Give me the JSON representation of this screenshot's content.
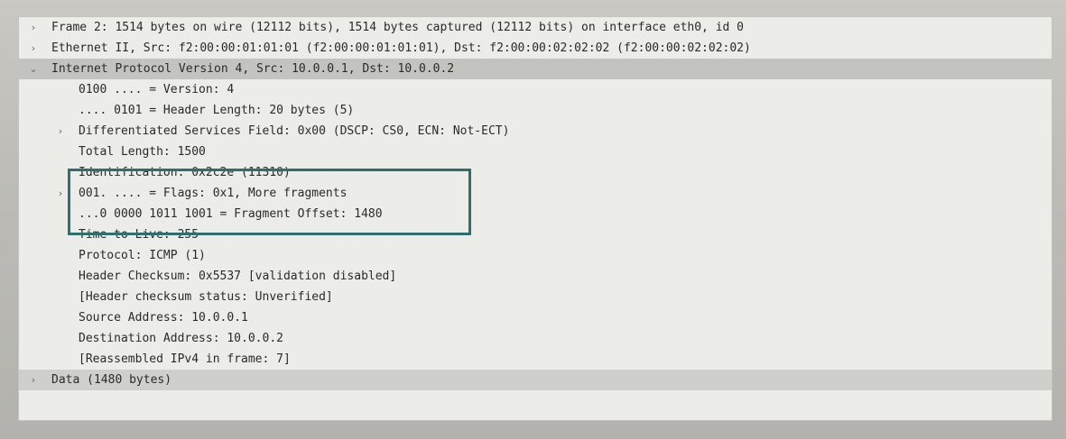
{
  "tree": {
    "rows": [
      {
        "level": 0,
        "caret": "›",
        "text": "Frame 2: 1514 bytes on wire (12112 bits), 1514 bytes captured (12112 bits) on interface eth0, id 0",
        "state": "normal"
      },
      {
        "level": 0,
        "caret": "›",
        "text": "Ethernet II, Src: f2:00:00:01:01:01 (f2:00:00:01:01:01), Dst: f2:00:00:02:02:02 (f2:00:00:02:02:02)",
        "state": "normal"
      },
      {
        "level": 0,
        "caret": "⌄",
        "text": "Internet Protocol Version 4, Src: 10.0.0.1, Dst: 10.0.0.2",
        "state": "selected"
      },
      {
        "level": 1,
        "caret": "",
        "text": "0100 .... = Version: 4",
        "state": "normal"
      },
      {
        "level": 1,
        "caret": "",
        "text": ".... 0101 = Header Length: 20 bytes (5)",
        "state": "normal"
      },
      {
        "level": 1,
        "caret": "›",
        "text": "Differentiated Services Field: 0x00 (DSCP: CS0, ECN: Not-ECT)",
        "state": "normal"
      },
      {
        "level": 1,
        "caret": "",
        "text": "Total Length: 1500",
        "state": "normal"
      },
      {
        "level": 1,
        "caret": "",
        "text": "Identification: 0x2c2e (11310)",
        "state": "normal"
      },
      {
        "level": 1,
        "caret": "›",
        "text": "001. .... = Flags: 0x1, More fragments",
        "state": "normal"
      },
      {
        "level": 1,
        "caret": "",
        "text": "...0 0000 1011 1001 = Fragment Offset: 1480",
        "state": "normal"
      },
      {
        "level": 1,
        "caret": "",
        "text": "Time to Live: 255",
        "state": "normal"
      },
      {
        "level": 1,
        "caret": "",
        "text": "Protocol: ICMP (1)",
        "state": "normal"
      },
      {
        "level": 1,
        "caret": "",
        "text": "Header Checksum: 0x5537 [validation disabled]",
        "state": "normal"
      },
      {
        "level": 1,
        "caret": "",
        "text": "[Header checksum status: Unverified]",
        "state": "normal"
      },
      {
        "level": 1,
        "caret": "",
        "text": "Source Address: 10.0.0.1",
        "state": "normal"
      },
      {
        "level": 1,
        "caret": "",
        "text": "Destination Address: 10.0.0.2",
        "state": "normal"
      },
      {
        "level": 1,
        "caret": "",
        "text": "[Reassembled IPv4 in frame: 7]",
        "state": "normal"
      },
      {
        "level": 0,
        "caret": "›",
        "text": "Data (1480 bytes)",
        "state": "data"
      }
    ]
  },
  "colors": {
    "highlight_box": "#2f6f6f",
    "selected_row": "#c3c3bf",
    "pane_bg": "#ecece8"
  }
}
